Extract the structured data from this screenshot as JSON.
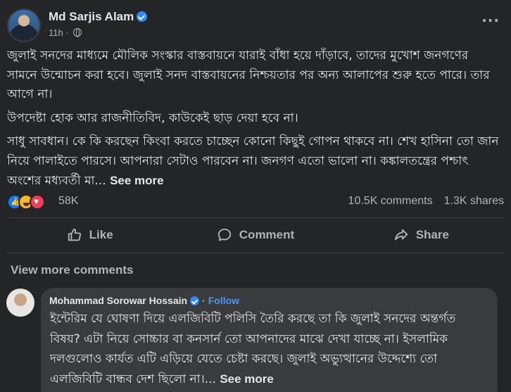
{
  "post": {
    "author": "Md Sarjis Alam",
    "time": "11h",
    "paragraphs": [
      "জুলাই সনদের মাধ্যমে মৌলিক সংস্কার বাস্তবায়নে যারাই বাঁধা হয়ে দাঁড়াবে, তাদের মুখোশ জনগণের সামনে উন্মোচন করা হবে। জুলাই সনদ বাস্তবায়নের নিশ্চয়তার পর অন্য আলাপের শুরু হতে পারে। তার আগে না।",
      "উপদেষ্টা হোক আর রাজনীতিবিদ, কাউকেই ছাড় দেয়া হবে না।",
      "সাধু সাবধান। কে কি করছেন কিংবা করতে চাচ্ছেন কোনো কিছুই গোপন থাকবে না। শেখ হাসিনা তো জান নিয়ে পালাইতে পারসে। আপনারা সেটাও পারবেন না। জনগণ এতো ভালো না। কঙ্কালতন্ত্রের পশ্চাৎ অংশের মধ্যবর্তী মা..."
    ],
    "see_more": "See more"
  },
  "stats": {
    "reactions_count": "58K",
    "comments": "10.5K comments",
    "shares": "1.3K shares",
    "reaction_icons": [
      "like-reaction-icon",
      "haha-reaction-icon",
      "love-reaction-icon"
    ]
  },
  "actions": {
    "like": "Like",
    "comment": "Comment",
    "share": "Share"
  },
  "view_more_comments": "View more comments",
  "comment": {
    "author": "Mohammad Sorowar Hossain",
    "separator": "·",
    "follow": "Follow",
    "text": "ইন্টেরিম যে ঘোষণা দিয়ে এলজিবিটি পলিসি তৈরি করছে তা কি জুলাই সনদের অন্তর্গত বিষয়? এটা নিয়ে সোচ্চার বা কনসার্ন তো আপনাদের মাঝে দেখা যাচ্ছে না। ইসলামিক দলগুলোও কার্যত এটি এড়িয়ে যেতে চেষ্টা করছে। জুলাই অভ্যুত্থানের উদ্দেশ্যে তো এলজিবিটি বান্ধব দেশ ছিলো না।...",
    "see_more": "See more"
  },
  "colors": {
    "background": "#242526",
    "bubble": "#3a3b3c",
    "verified": "#2d88ff",
    "follow": "#4599ff",
    "secondary_text": "#b0b3b8"
  }
}
